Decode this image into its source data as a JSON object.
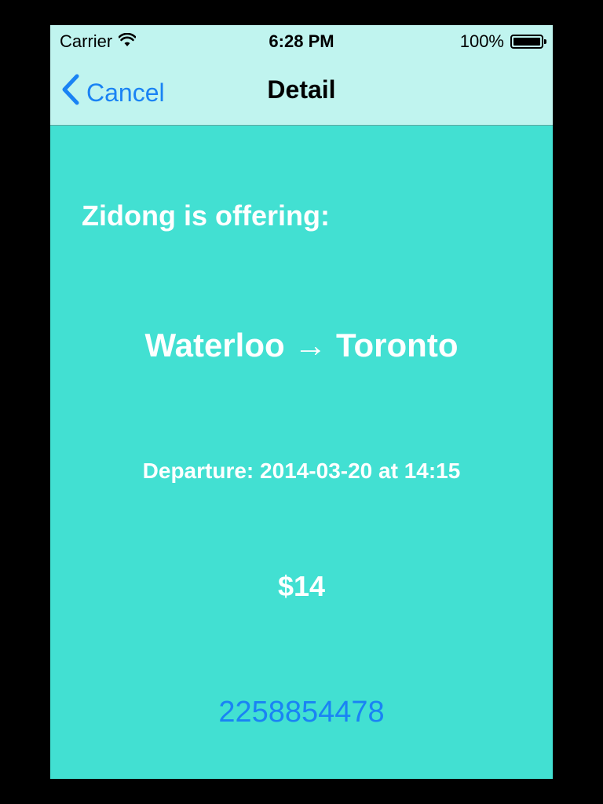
{
  "status_bar": {
    "carrier": "Carrier",
    "time": "6:28 PM",
    "battery_text": "100%"
  },
  "nav": {
    "back_label": "Cancel",
    "title": "Detail"
  },
  "detail": {
    "offer_heading": "Zidong is offering:",
    "origin": "Waterloo",
    "arrow": "→",
    "destination": "Toronto",
    "departure": "Departure: 2014-03-20 at 14:15",
    "price": "$14",
    "phone": "2258854478"
  },
  "colors": {
    "background": "#42e0d2",
    "nav_background": "#c0f4ef",
    "accent": "#1a83f4",
    "text": "#ffffff"
  },
  "icons": {
    "wifi": "wifi-icon",
    "battery": "battery-icon",
    "back": "chevron-left-icon"
  }
}
